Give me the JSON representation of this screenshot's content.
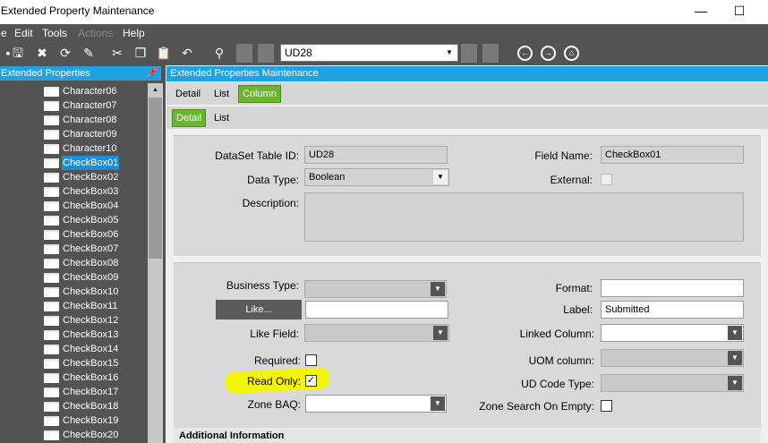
{
  "window": {
    "title": "Extended Property Maintenance",
    "min_glyph": "—",
    "max_glyph": "☐"
  },
  "menu": {
    "items": [
      "e",
      "Edit",
      "Tools",
      "Actions",
      "Help"
    ]
  },
  "toolbar": {
    "key_value": "UD28"
  },
  "left_panel": {
    "title": "Extended Properties",
    "items": [
      "Character06",
      "Character07",
      "Character08",
      "Character09",
      "Character10",
      "CheckBox01",
      "CheckBox02",
      "CheckBox03",
      "CheckBox04",
      "CheckBox05",
      "CheckBox06",
      "CheckBox07",
      "CheckBox08",
      "CheckBox09",
      "CheckBox10",
      "CheckBox11",
      "CheckBox12",
      "CheckBox13",
      "CheckBox14",
      "CheckBox15",
      "CheckBox16",
      "CheckBox17",
      "CheckBox18",
      "CheckBox19",
      "CheckBox20"
    ],
    "selected": "CheckBox01"
  },
  "main": {
    "title": "Extended Properties Maintenance",
    "tabs_top": [
      "Detail",
      "List",
      "Column"
    ],
    "tabs_sub": [
      "Detail",
      "List"
    ],
    "active_top": "Column",
    "active_sub": "Detail"
  },
  "form": {
    "dataset_label": "DataSet Table ID:",
    "dataset_value": "UD28",
    "fieldname_label": "Field Name:",
    "fieldname_value": "CheckBox01",
    "datatype_label": "Data Type:",
    "datatype_value": "Boolean",
    "external_label": "External:",
    "external_checked": false,
    "description_label": "Description:",
    "description_value": "",
    "businesstype_label": "Business Type:",
    "businesstype_value": "",
    "format_label": "Format:",
    "format_value": "",
    "like_button": "Like...",
    "like_value": "",
    "label_label": "Label:",
    "label_value": "Submitted",
    "likefield_label": "Like Field:",
    "likefield_value": "",
    "linkedcolumn_label": "Linked Column:",
    "linkedcolumn_value": "",
    "required_label": "Required:",
    "required_checked": false,
    "uomcolumn_label": "UOM column:",
    "uomcolumn_value": "",
    "readonly_label": "Read Only:",
    "readonly_checked": true,
    "readonly_glyph": "✓",
    "udcodetype_label": "UD Code Type:",
    "udcodetype_value": "",
    "zonebaq_label": "Zone BAQ:",
    "zonebaq_value": "",
    "zonesearch_label": "Zone Search On Empty:",
    "zonesearch_checked": false,
    "additional_info": "Additional Information"
  },
  "colors": {
    "accent": "#1fa3e0",
    "tab_active": "#6bb52e",
    "highlight": "#f5f500",
    "chrome": "#535353"
  }
}
